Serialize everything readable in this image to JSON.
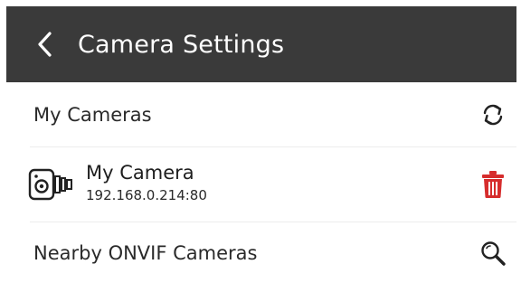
{
  "header": {
    "back_icon": "chevron-left-icon",
    "title": "Camera Settings"
  },
  "my_cameras": {
    "label": "My Cameras",
    "refresh_icon": "refresh-icon"
  },
  "cameras": [
    {
      "name": "My Camera",
      "address": "192.168.0.214:80",
      "icon": "camera-icon",
      "delete_icon": "trash-icon"
    }
  ],
  "nearby": {
    "label": "Nearby ONVIF Cameras",
    "search_icon": "search-icon"
  },
  "colors": {
    "header_bg": "#3a3a3a",
    "delete_red": "#d62d2d"
  }
}
